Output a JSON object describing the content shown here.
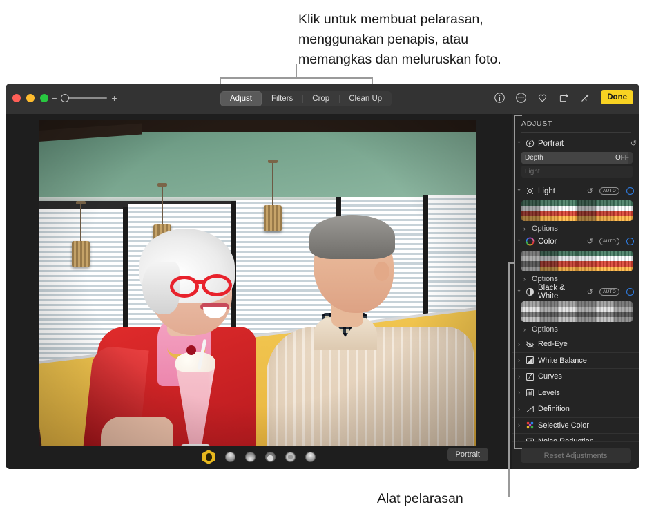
{
  "callouts": {
    "top": "Klik untuk membuat pelarasan,\nmenggunakan penapis, atau\nmemangkas dan meluruskan foto.",
    "bottom": "Alat pelarasan"
  },
  "window": {
    "traffic_lights": [
      "close",
      "minimize",
      "zoom"
    ],
    "zoom_slider": {
      "minus": "−",
      "plus": "+",
      "value": 0
    },
    "segmented": {
      "selected": "Adjust",
      "items": [
        {
          "label": "Adjust"
        },
        {
          "label": "Filters"
        },
        {
          "label": "Crop"
        },
        {
          "label": "Clean Up"
        }
      ]
    },
    "toolbar_right": {
      "icons": [
        {
          "name": "info-icon"
        },
        {
          "name": "more-options-icon"
        },
        {
          "name": "favorite-heart-icon"
        },
        {
          "name": "rotate-icon"
        },
        {
          "name": "enhance-wand-icon"
        }
      ],
      "done_label": "Done"
    }
  },
  "photo": {
    "portrait_badge": "Portrait",
    "effects": [
      {
        "name": "portrait-effect",
        "selected": true
      },
      {
        "name": "natural-light-effect",
        "selected": false
      },
      {
        "name": "studio-light-effect",
        "selected": false
      },
      {
        "name": "contour-light-effect",
        "selected": false
      },
      {
        "name": "stage-light-effect",
        "selected": false
      },
      {
        "name": "stage-light-mono-effect",
        "selected": false
      }
    ]
  },
  "sidebar": {
    "title": "ADJUST",
    "portrait": {
      "label": "Portrait",
      "reset": "↺",
      "sliders": [
        {
          "label": "Depth",
          "value": "OFF",
          "disabled": false
        },
        {
          "label": "Light",
          "value": "",
          "disabled": true
        }
      ]
    },
    "sections": [
      {
        "label": "Light",
        "icon": "brightness-icon",
        "expanded": true,
        "reset": "↺",
        "auto": "AUTO",
        "has_checkbox": true,
        "options_label": "Options"
      },
      {
        "label": "Color",
        "icon": "color-wheel-icon",
        "expanded": true,
        "reset": "↺",
        "auto": "AUTO",
        "has_checkbox": true,
        "options_label": "Options"
      },
      {
        "label": "Black & White",
        "icon": "contrast-circle-icon",
        "expanded": true,
        "reset": "↺",
        "auto": "AUTO",
        "has_checkbox": true,
        "options_label": "Options"
      }
    ],
    "list_items": [
      {
        "label": "Red-Eye",
        "icon": "eye-slash-icon"
      },
      {
        "label": "White Balance",
        "icon": "white-balance-icon"
      },
      {
        "label": "Curves",
        "icon": "curves-icon"
      },
      {
        "label": "Levels",
        "icon": "levels-icon"
      },
      {
        "label": "Definition",
        "icon": "definition-icon"
      },
      {
        "label": "Selective Color",
        "icon": "selective-color-icon"
      },
      {
        "label": "Noise Reduction",
        "icon": "noise-reduction-icon"
      }
    ],
    "reset_button": "Reset Adjustments"
  },
  "colors": {
    "accent_done": "#f8d222",
    "checkbox_blue": "#2f7fe8",
    "window_bg": "#1e1e1e",
    "titlebar_bg": "#333333",
    "sidebar_bg": "#242424"
  }
}
